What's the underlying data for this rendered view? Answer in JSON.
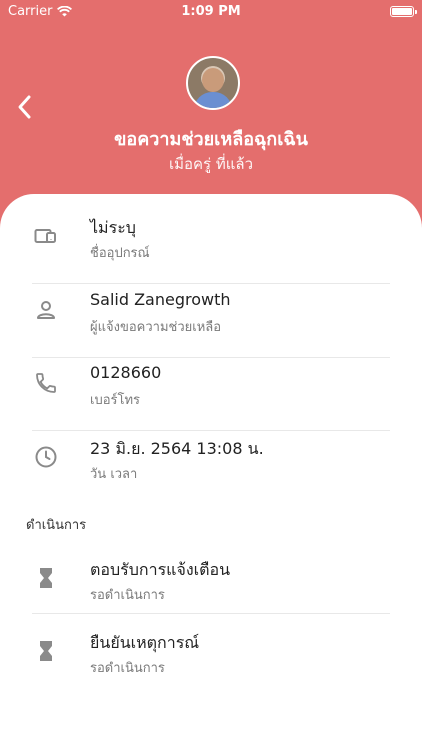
{
  "status": {
    "carrier": "Carrier",
    "time": "1:09 PM"
  },
  "header": {
    "title": "ขอความช่วยเหลือฉุกเฉิน",
    "subtitle": "เมื่อครู่ ที่แล้ว"
  },
  "details": [
    {
      "icon": "devices-icon",
      "primary": "ไม่ระบุ",
      "secondary": "ชื่ออุปกรณ์"
    },
    {
      "icon": "person-icon",
      "primary": "Salid Zanegrowth",
      "secondary": "ผู้แจ้งขอความช่วยเหลือ"
    },
    {
      "icon": "phone-icon",
      "primary": "0128660",
      "secondary": "เบอร์โทร"
    },
    {
      "icon": "clock-icon",
      "primary": "23 มิ.ย. 2564 13:08 น.",
      "secondary": "วัน เวลา"
    }
  ],
  "section_title": "ดำเนินการ",
  "actions": [
    {
      "icon": "hourglass-icon",
      "primary": "ตอบรับการแจ้งเตือน",
      "secondary": "รอดำเนินการ"
    },
    {
      "icon": "hourglass-icon",
      "primary": "ยืนยันเหตุการณ์",
      "secondary": "รอดำเนินการ"
    }
  ],
  "colors": {
    "header_bg": "#e46e6d",
    "text": "#222222",
    "muted": "#7a7a7a",
    "icon": "#8a8a8a"
  }
}
